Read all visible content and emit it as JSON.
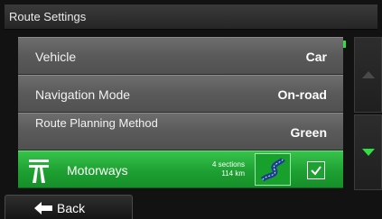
{
  "header": {
    "title": "Route Settings"
  },
  "settings": [
    {
      "label": "Vehicle",
      "value": "Car"
    },
    {
      "label": "Navigation Mode",
      "value": "On-road"
    },
    {
      "label": "Route Planning Method",
      "value": "Green"
    }
  ],
  "motorways": {
    "label": "Motorways",
    "sections": "4 sections",
    "distance": "114 km",
    "checked": true
  },
  "footer": {
    "back_label": "Back"
  },
  "colors": {
    "accent": "#1ea032",
    "indicator": "#2ee040"
  }
}
